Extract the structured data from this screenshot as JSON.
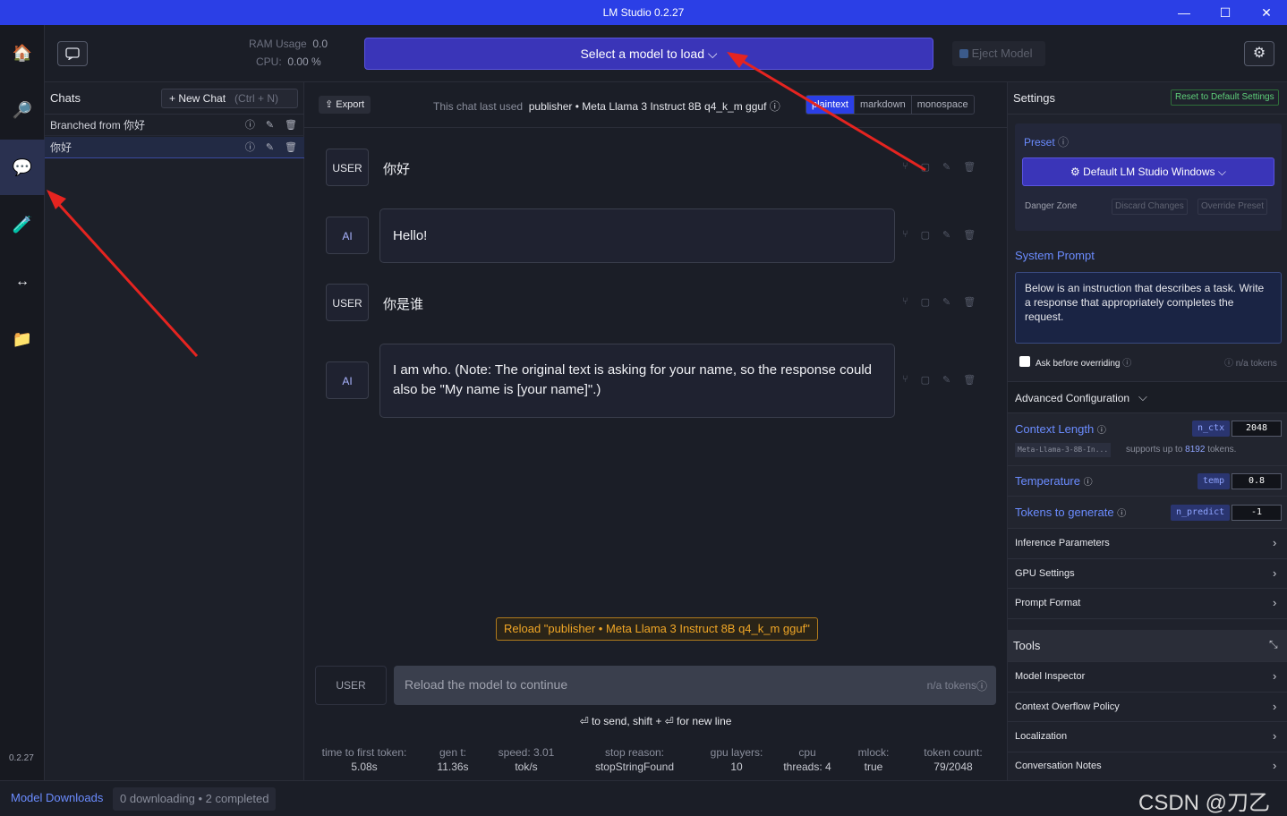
{
  "window": {
    "title": "LM Studio 0.2.27",
    "min": "—",
    "max": "☐",
    "close": "✕"
  },
  "rail": {
    "version": "0.2.27",
    "items": [
      {
        "name": "home",
        "glyph": "🏠"
      },
      {
        "name": "search",
        "glyph": "🔎"
      },
      {
        "name": "chat",
        "glyph": "💬"
      },
      {
        "name": "playground",
        "glyph": "🧪"
      },
      {
        "name": "server",
        "glyph": "↔"
      },
      {
        "name": "folder",
        "glyph": "📁"
      }
    ]
  },
  "topbar": {
    "ram_label": "RAM Usage",
    "ram_value": "0.0",
    "cpu_label": "CPU:",
    "cpu_value": "0.00 %",
    "select_model": "Select a model to load",
    "eject": "Eject Model"
  },
  "chats": {
    "header": "Chats",
    "new_chat": "+ New Chat",
    "shortcut": "(Ctrl + N)",
    "items": [
      {
        "label": "Branched from 你好"
      },
      {
        "label": "你好"
      }
    ]
  },
  "chat": {
    "export": "Export",
    "last_used_prefix": "This chat last used",
    "last_used_model": "publisher • Meta Llama 3 Instruct 8B q4_k_m gguf",
    "formats": [
      "plaintext",
      "markdown",
      "monospace"
    ],
    "messages": [
      {
        "role": "USER",
        "text": "你好"
      },
      {
        "role": "AI",
        "text": "Hello!"
      },
      {
        "role": "USER",
        "text": "你是谁"
      },
      {
        "role": "AI",
        "text": "I am who. (Note: The original text is asking for your name, so the response could also be \"My name is [your name]\".)"
      }
    ],
    "reload": "Reload \"publisher • Meta Llama 3 Instruct 8B q4_k_m gguf\"",
    "input_role": "USER",
    "input_placeholder": "Reload the model to continue",
    "input_tokens": "n/a tokens",
    "hint": "⏎ to send, shift + ⏎ for new line",
    "stats": [
      {
        "label": "time to first token:",
        "value": "5.08s"
      },
      {
        "label": "gen t:",
        "value": "11.36s"
      },
      {
        "label": "speed: 3.01",
        "value": "tok/s"
      },
      {
        "label": "stop reason:",
        "value": "stopStringFound"
      },
      {
        "label": "gpu layers:",
        "value": "10"
      },
      {
        "label": "cpu",
        "value": "threads: 4"
      },
      {
        "label": "mlock:",
        "value": "true"
      },
      {
        "label": "token count:",
        "value": "79/2048"
      }
    ]
  },
  "settings": {
    "header": "Settings",
    "reset": "Reset to Default Settings",
    "preset_label": "Preset",
    "preset_value": "Default LM Studio Windows",
    "danger_zone": "Danger Zone",
    "discard": "Discard Changes",
    "override": "Override Preset",
    "system_prompt_label": "System Prompt",
    "system_prompt": "Below is an instruction that describes a task. Write a response that appropriately completes the request.",
    "ask_override": "Ask before overriding",
    "prompt_tokens": "n/a tokens",
    "advanced": "Advanced Configuration",
    "context_length": {
      "label": "Context Length",
      "tag": "n_ctx",
      "value": "2048"
    },
    "model_file": "Meta-Llama-3-8B-In...",
    "supports_prefix": "supports up to",
    "supports_value": "8192",
    "supports_suffix": "tokens.",
    "temperature": {
      "label": "Temperature",
      "tag": "temp",
      "value": "0.8"
    },
    "tokens_gen": {
      "label": "Tokens to generate",
      "tag": "n_predict",
      "value": "-1"
    },
    "sections": [
      "Inference Parameters",
      "GPU Settings",
      "Prompt Format"
    ],
    "tools_header": "Tools",
    "tools": [
      "Model Inspector",
      "Context Overflow Policy",
      "Localization",
      "Conversation Notes"
    ]
  },
  "statusbar": {
    "downloads": "Model Downloads",
    "download_status": "0 downloading • 2 completed"
  },
  "watermark": "CSDN @刀乙丙"
}
